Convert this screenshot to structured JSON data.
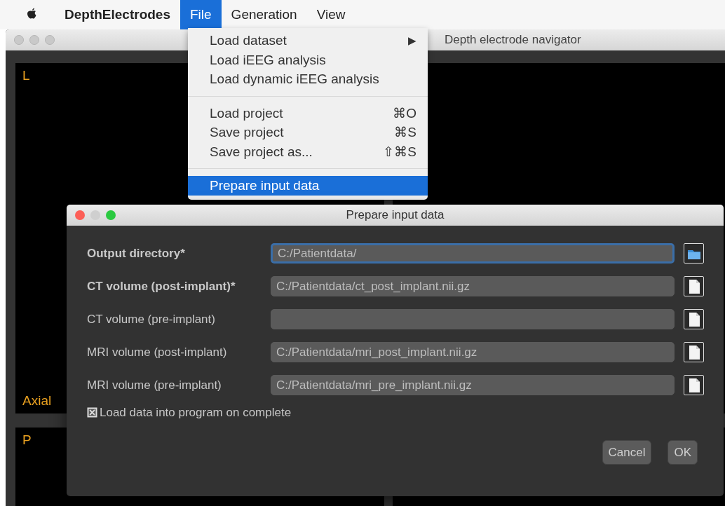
{
  "menu_bar": {
    "app_name": "DepthElectrodes",
    "menus": [
      {
        "label": "File",
        "selected": true
      },
      {
        "label": "Generation",
        "selected": false
      },
      {
        "label": "View",
        "selected": false
      }
    ]
  },
  "main_window": {
    "title": "Depth electrode navigator",
    "views": [
      {
        "top_label": "L",
        "bottom_label": "Axial"
      },
      {
        "top_label": "P"
      }
    ]
  },
  "file_menu": {
    "items": [
      {
        "kind": "item",
        "label": "Load dataset",
        "submenu_arrow": "▶",
        "selected": false
      },
      {
        "kind": "item",
        "label": "Load iEEG analysis",
        "selected": false
      },
      {
        "kind": "item",
        "label": "Load dynamic iEEG analysis",
        "selected": false
      },
      {
        "kind": "separator"
      },
      {
        "kind": "item",
        "label": "Load project",
        "shortcut": "⌘O",
        "selected": false
      },
      {
        "kind": "item",
        "label": "Save project",
        "shortcut": "⌘S",
        "selected": false
      },
      {
        "kind": "item",
        "label": "Save project as...",
        "shortcut": "⇧⌘S",
        "selected": false
      },
      {
        "kind": "separator"
      },
      {
        "kind": "item",
        "label": "Prepare input data",
        "selected": true
      }
    ]
  },
  "dialog": {
    "title": "Prepare input data",
    "fields": [
      {
        "label": "Output directory*",
        "required": true,
        "value": "C:/Patientdata/",
        "focused": true,
        "kind": "folder"
      },
      {
        "label": "CT volume (post-implant)*",
        "required": true,
        "value": "C:/Patientdata/ct_post_implant.nii.gz",
        "focused": false,
        "kind": "file"
      },
      {
        "label": "CT volume (pre-implant)",
        "required": false,
        "focused": false,
        "kind": "file"
      },
      {
        "label": "MRI volume (post-implant)",
        "required": false,
        "value": "C:/Patientdata/mri_post_implant.nii.gz",
        "focused": false,
        "kind": "file"
      },
      {
        "label": "MRI volume (pre-implant)",
        "required": false,
        "value": "C:/Patientdata/mri_pre_implant.nii.gz",
        "focused": false,
        "kind": "file"
      }
    ],
    "load_option": {
      "label": "Load data into program on complete",
      "checked": true
    },
    "buttons": [
      "Cancel",
      "OK"
    ]
  }
}
